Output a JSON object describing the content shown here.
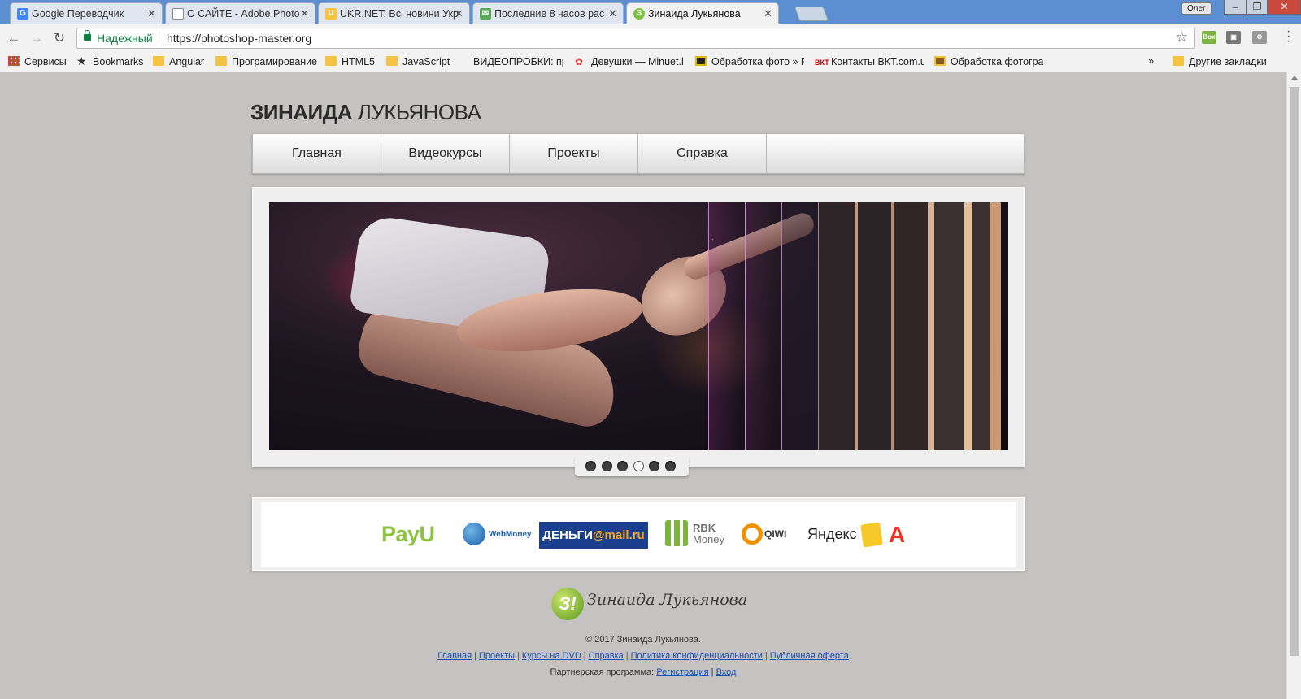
{
  "browser": {
    "tabs": [
      {
        "title": "Google Переводчик",
        "icon": "google-translate-icon"
      },
      {
        "title": "О САЙТЕ - Adobe Photo",
        "icon": "page-icon"
      },
      {
        "title": "UKR.NET: Всі новини Укр",
        "icon": "ukrnet-icon"
      },
      {
        "title": "Последние 8 часов рас",
        "icon": "mail-icon"
      },
      {
        "title": "Зинаида Лукьянова",
        "icon": "site-icon"
      }
    ],
    "user": "Олег",
    "secure_label": "Надежный",
    "url": "https://photoshop-master.org",
    "bookmarks": [
      {
        "label": "Сервисы",
        "icon": "apps-grid-icon"
      },
      {
        "label": "Bookmarks",
        "icon": "star-icon"
      },
      {
        "label": "Angular",
        "icon": "folder-icon"
      },
      {
        "label": "Програмирование",
        "icon": "folder-icon"
      },
      {
        "label": "HTML5",
        "icon": "folder-icon"
      },
      {
        "label": "JavaScript",
        "icon": "folder-icon"
      },
      {
        "label": "ВИДЕОПРОБКИ: про",
        "icon": "page-icon"
      },
      {
        "label": "Девушки — Minuet.l",
        "icon": "site-icon"
      },
      {
        "label": "Обработка фото » Р",
        "icon": "site-icon"
      },
      {
        "label": "Контакты ВКТ.com.u",
        "icon": "site-icon"
      },
      {
        "label": "Обработка фотограф",
        "icon": "site-icon"
      }
    ],
    "more_bookmarks": "»",
    "other_bookmarks": "Другие закладки"
  },
  "site": {
    "title_bold": "ЗИНАИДА",
    "title_rest": "ЛУКЬЯНОВА",
    "nav": [
      "Главная",
      "Видеокурсы",
      "Проекты",
      "Справка"
    ],
    "slider": {
      "total": 6,
      "active_index": 3
    },
    "payments": {
      "payu": "PayU",
      "webmoney": "WebMoney",
      "dengi_prefix": "ДЕНЬГИ",
      "dengi_mail": "@mail.ru",
      "rbk_top": "RBK",
      "rbk_bottom": "Money",
      "qiwi": "QIWI",
      "yandex": "Яндекс",
      "alfa": "А"
    },
    "footer": {
      "logo_badge": "З!",
      "logo_script": "Зинаида Лукьянова",
      "copyright": "© 2017 Зинаида Лукьянова.",
      "links": [
        "Главная",
        "Проекты",
        "Курсы на DVD",
        "Справка",
        "Политика конфиденциальности",
        "Публичная оферта"
      ],
      "partner_label": "Партнерская программа:",
      "partner_links": [
        "Регистрация",
        "Вход"
      ]
    }
  }
}
